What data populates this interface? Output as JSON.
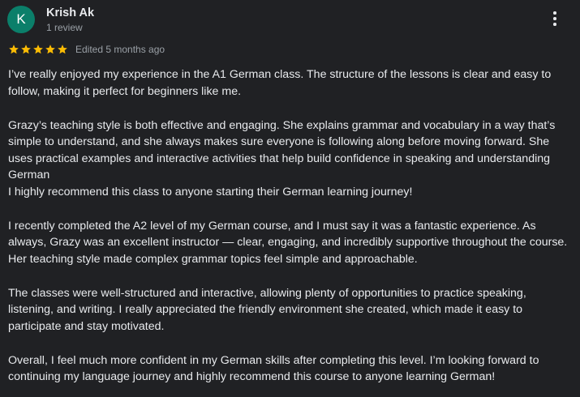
{
  "reviewer": {
    "initial": "K",
    "avatar_color": "#0b7f6a",
    "name": "Krish Ak",
    "review_count": "1 review"
  },
  "menu": {
    "icon": "more-vert-icon"
  },
  "rating": {
    "stars": 5,
    "max_stars": 5,
    "star_color": "#fbbc04",
    "edited_label": "Edited 5 months ago"
  },
  "paragraphs": [
    [
      "I’ve really enjoyed my experience in the A1 German class. The structure of the lessons is clear and easy to follow, making it perfect for beginners like me."
    ],
    [
      "Grazy’s teaching style is both effective and engaging. She explains grammar and vocabulary in a way that’s simple to understand, and she always makes sure everyone is following along before moving forward. She uses practical examples and interactive activities that help build confidence in speaking and understanding German",
      "I highly recommend this class to anyone starting their German learning journey!"
    ],
    [
      "I recently completed the A2 level of my German course, and I must say it was a fantastic experience. As always, Grazy was an excellent instructor — clear, engaging, and incredibly supportive throughout the course. Her teaching style made complex grammar topics feel simple and approachable."
    ],
    [
      "The classes were well-structured and interactive, allowing plenty of opportunities to practice speaking, listening, and writing. I really appreciated the friendly environment she created, which made it easy to participate and stay motivated."
    ],
    [
      "Overall, I feel much more confident in my German skills after completing this level. I’m looking forward to continuing my language journey and highly recommend this course to anyone learning German!"
    ]
  ]
}
